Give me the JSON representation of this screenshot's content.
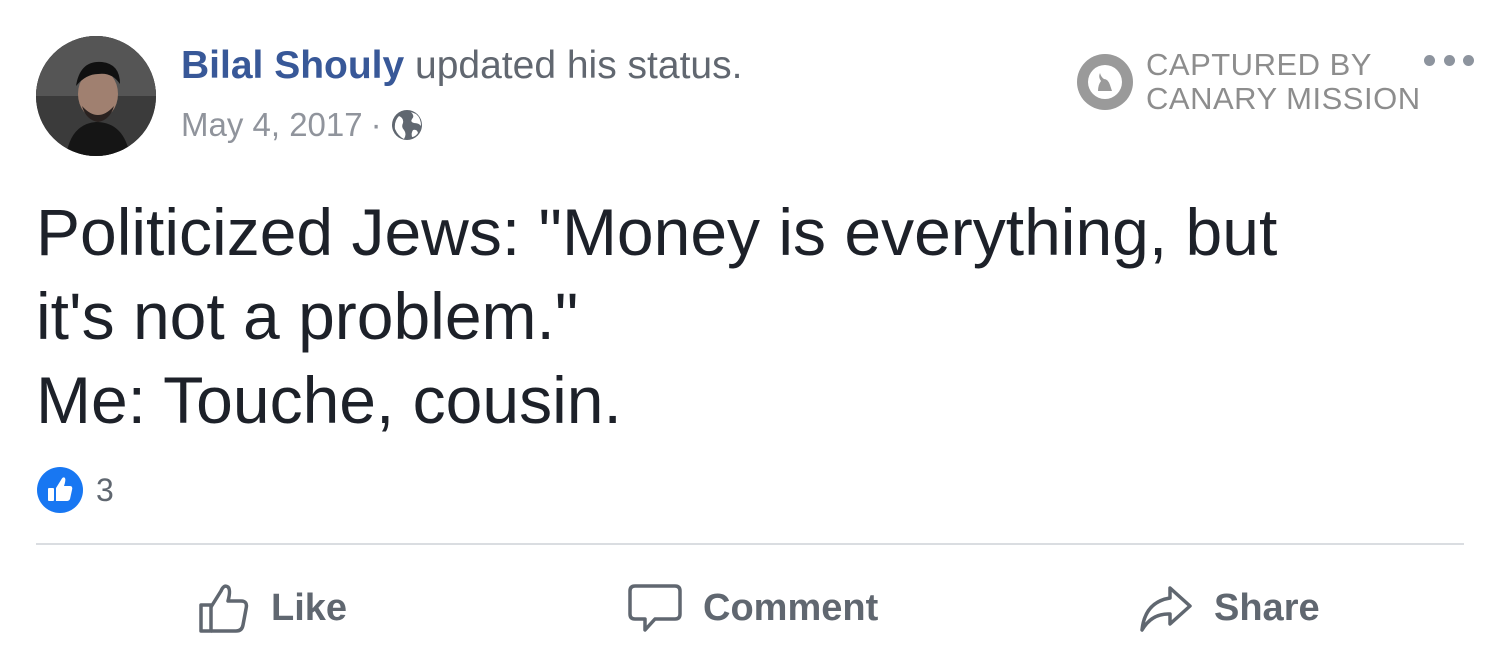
{
  "post": {
    "author_name": "Bilal Shouly",
    "action_text": " updated his status.",
    "date": "May 4, 2017",
    "separator": "·",
    "privacy_icon": "globe-icon",
    "body_lines": [
      "Politicized Jews: \"Money is everything, but",
      "it's not a problem.\"",
      "Me: Touche, cousin."
    ],
    "reaction_icon": "like-reaction-icon",
    "reaction_count": "3"
  },
  "watermark": {
    "line1": "CAPTURED BY",
    "line2": "CANARY MISSION"
  },
  "actions": {
    "like_label": "Like",
    "comment_label": "Comment",
    "share_label": "Share"
  },
  "colors": {
    "name_link": "#385898",
    "secondary_text": "#616770",
    "body_text": "#1d2129",
    "like_blue": "#1877f2",
    "divider": "#dadde1"
  }
}
